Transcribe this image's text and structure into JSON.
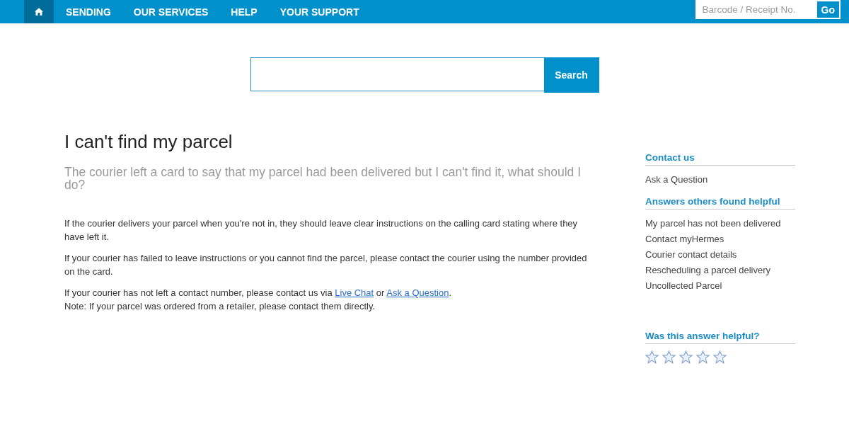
{
  "nav": {
    "items": [
      {
        "kind": "home",
        "selected": true
      },
      {
        "label": "SENDING",
        "selected": false
      },
      {
        "label": "OUR SERVICES",
        "selected": false
      },
      {
        "label": "HELP",
        "selected": false
      },
      {
        "label": "YOUR SUPPORT",
        "selected": false
      }
    ],
    "tracking": {
      "placeholder": "Barcode / Receipt No.",
      "button": "Go"
    }
  },
  "search": {
    "button": "Search"
  },
  "article": {
    "title": "I can't find my parcel",
    "question": "The courier left a card to say that my parcel had been delivered but I can't find it, what should I do?",
    "paragraphs": [
      [
        {
          "kind": "text",
          "text": "If the courier delivers your parcel when you're not in, they should leave clear instructions on the calling card stating where they have left it."
        }
      ],
      [
        {
          "kind": "text",
          "text": "If your courier has failed to leave instructions or you cannot find the parcel, please contact the courier using the number provided on the card."
        }
      ],
      [
        {
          "kind": "text",
          "text": "If your courier has not left a contact number, please contact us via "
        },
        {
          "kind": "link",
          "text": "Live Chat"
        },
        {
          "kind": "text",
          "text": " or "
        },
        {
          "kind": "link",
          "text": "Ask a Question"
        },
        {
          "kind": "text",
          "text": "."
        },
        {
          "kind": "break"
        },
        {
          "kind": "text",
          "text": "Note: If your parcel was ordered from a retailer, please contact them directly."
        }
      ]
    ]
  },
  "sidebar": {
    "sections": [
      {
        "heading": "Contact us",
        "links": [
          "Ask a Question"
        ]
      },
      {
        "heading": "Answers others found helpful",
        "links": [
          "My parcel has not been delivered",
          "Contact myHermes",
          "Courier contact details",
          "Rescheduling a parcel delivery",
          "Uncollected Parcel"
        ]
      }
    ],
    "rating": {
      "heading": "Was this answer helpful?",
      "stars": 0
    }
  }
}
